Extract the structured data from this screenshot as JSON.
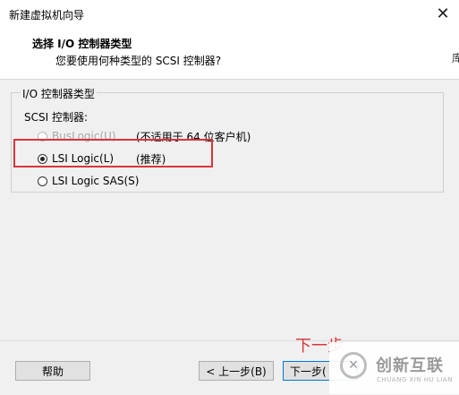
{
  "window": {
    "title": "新建虚拟机向导",
    "close_glyph": "✕"
  },
  "header": {
    "title": "选择 I/O 控制器类型",
    "subtitle": "您要使用何种类型的 SCSI 控制器?",
    "edge_glyph": "库"
  },
  "group": {
    "legend": "I/O 控制器类型",
    "scsi_label": "SCSI 控制器:",
    "options": [
      {
        "label": "BusLogic(U)",
        "note": "(不适用于 64 位客户机)",
        "checked": false,
        "disabled": true
      },
      {
        "label": "LSI Logic(L)",
        "note": "(推荐)",
        "checked": true,
        "disabled": false
      },
      {
        "label": "LSI Logic SAS(S)",
        "note": "",
        "checked": false,
        "disabled": false
      }
    ]
  },
  "footer": {
    "help": "帮助",
    "back": "< 上一步(B)",
    "next": "下一步("
  },
  "annotation": {
    "text": "下一步",
    "color": "#d9353b"
  },
  "watermark": {
    "main": "创新互联",
    "sub": "CHUANG XIN HU LIAN",
    "logo_glyph": "✕"
  }
}
